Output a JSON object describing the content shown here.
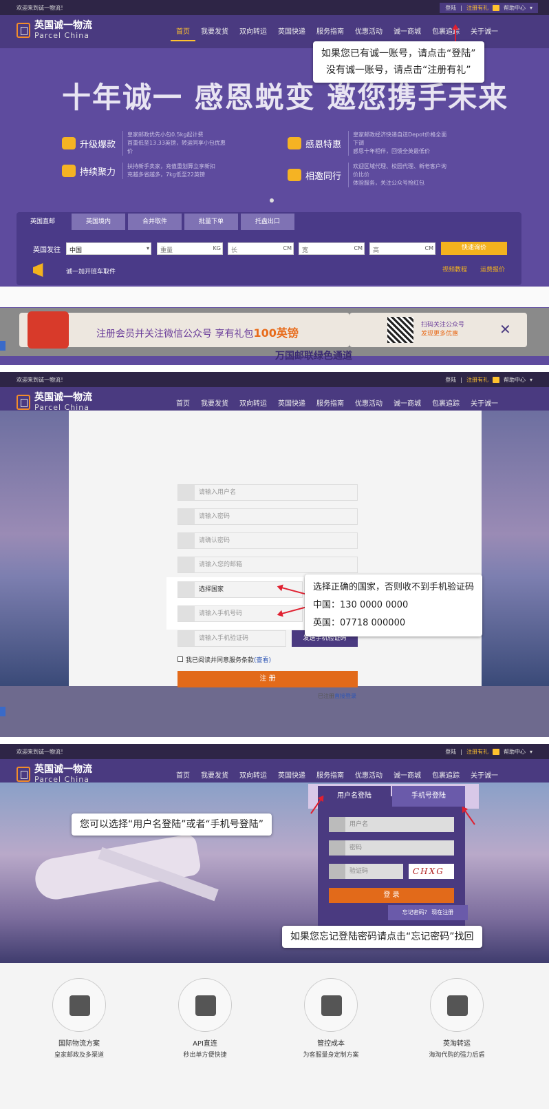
{
  "site": {
    "welcome": "欢迎来到诚一物流！",
    "login": "登陆",
    "register": "注册有礼",
    "help": "帮助中心",
    "logo_cn": "英国诚一物流",
    "logo_en": "Parcel China",
    "nav": [
      "首页",
      "我要发货",
      "双向转运",
      "英国快递",
      "服务指南",
      "优惠活动",
      "诚一商城",
      "包裹追踪",
      "关于诚一"
    ]
  },
  "panel1": {
    "hero_title": "十年诚一 感恩蜕变 邀您携手未来",
    "features": [
      {
        "name": "升级爆款",
        "desc1": "皇家邮政优先小包0.5kg起计费",
        "desc2": "首重低至13.33英镑，转运同享小包优惠价"
      },
      {
        "name": "感恩特惠",
        "desc1": "皇家邮政经济快递自送Depot价格全面下调",
        "desc2": "感恩十年相伴，回馈全英最低价"
      },
      {
        "name": "持续聚力",
        "desc1": "扶持新手卖家，充值重划算立享新扣",
        "desc2": "充越多省越多，7kg低至22英镑"
      },
      {
        "name": "相邀同行",
        "desc1": "欢迎区域代理、校园代理、新老客户询价比价",
        "desc2": "体验服务，关注公众号抢红包"
      }
    ],
    "tabs": [
      "英国直邮",
      "英国境内",
      "合并取件",
      "批量下单",
      "托盘出口"
    ],
    "ship_label": "英国发往",
    "country_value": "中国",
    "weight_placeholder": "重量",
    "length_placeholder": "长",
    "width_placeholder": "宽",
    "height_placeholder": "高",
    "unit_kg": "KG",
    "unit_cm": "CM",
    "quote_button": "快速询价",
    "pickup_text": "诚一加开班车取件",
    "video_link": "视频教程",
    "price_link": "运费报价",
    "banner_text": "注册会员并关注微信公众号",
    "banner_gift": "享有礼包",
    "banner_amount": "100英镑",
    "qr_line1": "扫码关注公众号",
    "qr_line2": "发现更多优惠",
    "below_text": "万国邮联绿色通道",
    "callout_line1": "如果您已有诚一账号，请点击“登陆”",
    "callout_line2": "没有诚一账号，请点击“注册有礼”"
  },
  "panel2": {
    "username_placeholder": "请输入用户名",
    "password_placeholder": "请输入密码",
    "confirm_placeholder": "请确认密码",
    "email_placeholder": "请输入您的邮箱",
    "country_placeholder": "选择国家",
    "phone_placeholder": "请输入手机号码",
    "sms_placeholder": "请输入手机验证码",
    "sms_button": "发送手机验证码",
    "agree_text": "我已阅读并同意服务条款",
    "agree_link": "(查看)",
    "register_button": "注 册",
    "login_prefix": "已注册",
    "login_link": "直接登录",
    "callout_line1": "选择正确的国家，否则收不到手机验证码",
    "callout_line2": "中国：130 0000 0000",
    "callout_line3": "英国：07718 000000"
  },
  "panel3": {
    "tab_username": "用户名登陆",
    "tab_phone": "手机号登陆",
    "username_placeholder": "用户名",
    "password_placeholder": "密码",
    "captcha_placeholder": "验证码",
    "captcha_value": "CHXG",
    "login_button": "登 录",
    "forgot_link": "忘记密码？ 现在注册",
    "callout_tabs": "您可以选择“用户名登陆”或者“手机号登陆”",
    "callout_forgot": "如果您忘记登陆密码请点击“忘记密码”找回",
    "services": [
      {
        "name": "国际物流方案",
        "desc": "皇家邮政及多渠道"
      },
      {
        "name": "API直连",
        "desc": "秒出单方便快捷"
      },
      {
        "name": "管控成本",
        "desc": "为客服量身定制方案"
      },
      {
        "name": "英淘转运",
        "desc": "海淘代购的强力后盾"
      }
    ]
  },
  "colors": {
    "brand_purple": "#4a3a80",
    "accent_gold": "#ffc22e",
    "button_orange": "#e26a1a",
    "arrow_red": "#e02030"
  }
}
